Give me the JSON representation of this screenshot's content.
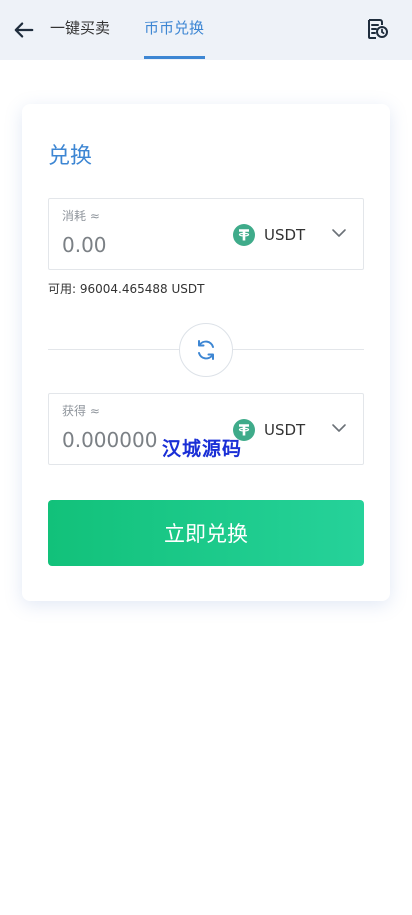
{
  "header": {
    "back_icon": "arrow-left-icon",
    "tabs": [
      {
        "label": "一键买卖"
      },
      {
        "label": "币币兑换"
      }
    ],
    "active_tab": 1,
    "records_icon": "records-clock-icon",
    "accent_color": "#3d86d3"
  },
  "card": {
    "title": "兑换",
    "pay": {
      "label": "消耗 ≈",
      "value": "0.00",
      "coin": "USDT"
    },
    "available": "可用: 96004.465488 USDT",
    "swap_icon": "swap-refresh-icon",
    "receive": {
      "label": "获得 ≈",
      "value": "0.000000",
      "coin": "USDT"
    },
    "watermark": "汉城源码",
    "submit_label": "立即兑换",
    "submit_colors": [
      "#12c17a",
      "#26d29a"
    ]
  }
}
